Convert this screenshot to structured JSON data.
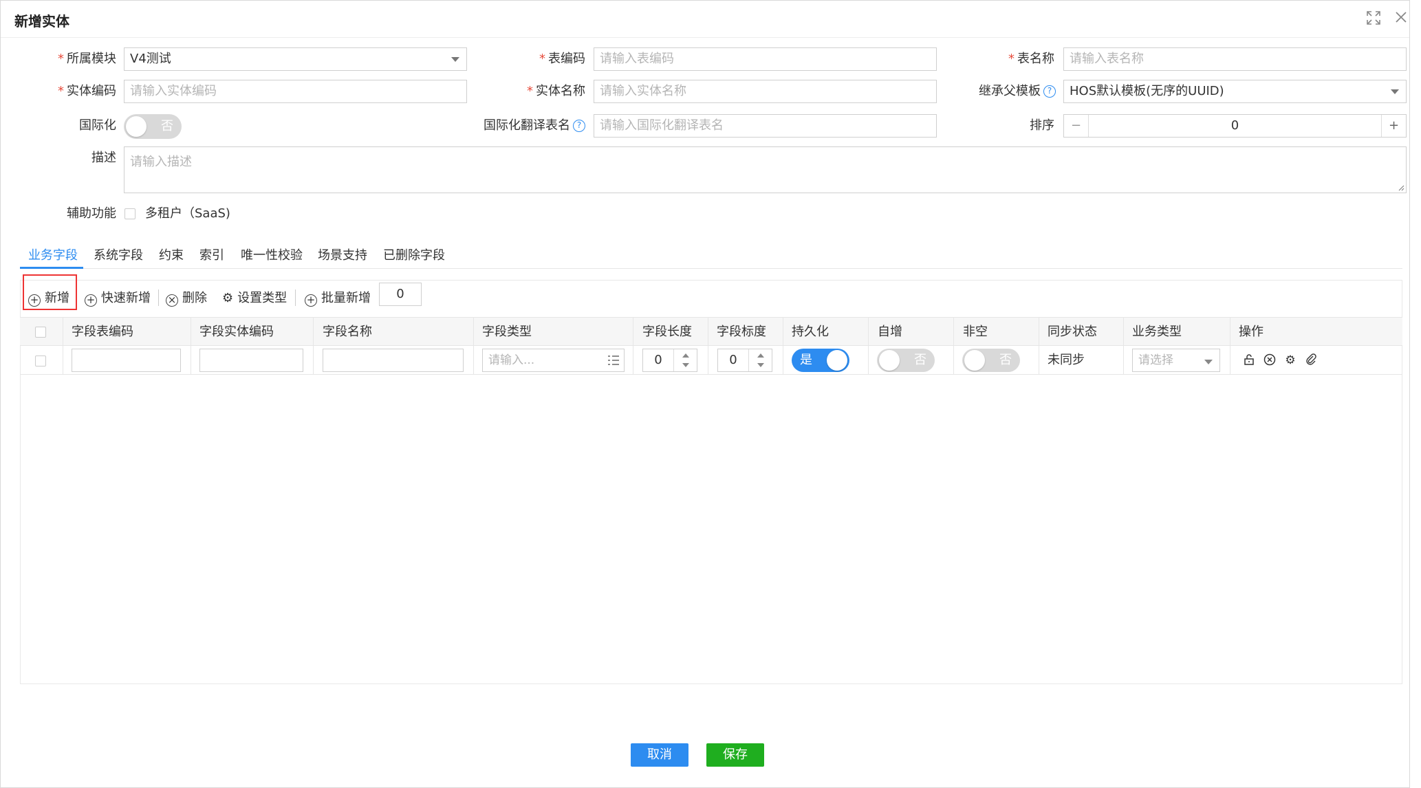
{
  "dialog": {
    "title": "新增实体"
  },
  "form": {
    "module": {
      "label": "所属模块",
      "value": "V4测试"
    },
    "table_code": {
      "label": "表编码",
      "placeholder": "请输入表编码"
    },
    "table_name": {
      "label": "表名称",
      "placeholder": "请输入表名称"
    },
    "entity_code": {
      "label": "实体编码",
      "placeholder": "请输入实体编码"
    },
    "entity_name": {
      "label": "实体名称",
      "placeholder": "请输入实体名称"
    },
    "parent_template": {
      "label": "继承父模板",
      "value": "HOS默认模板(无序的UUID)"
    },
    "i18n": {
      "label": "国际化",
      "toggle": "否"
    },
    "i18n_table": {
      "label": "国际化翻译表名",
      "placeholder": "请输入国际化翻译表名"
    },
    "sort": {
      "label": "排序",
      "minus": "−",
      "plus": "+",
      "value": "0"
    },
    "description": {
      "label": "描述",
      "placeholder": "请输入描述"
    },
    "aux": {
      "label": "辅助功能",
      "option": "多租户（SaaS)"
    }
  },
  "tabs": [
    "业务字段",
    "系统字段",
    "约束",
    "索引",
    "唯一性校验",
    "场景支持",
    "已删除字段"
  ],
  "toolbar": {
    "add": "新增",
    "quick_add": "快速新增",
    "delete": "删除",
    "set_type": "设置类型",
    "batch_add": "批量新增",
    "batch_count": "0"
  },
  "table": {
    "columns": [
      "字段表编码",
      "字段实体编码",
      "字段名称",
      "字段类型",
      "字段长度",
      "字段标度",
      "持久化",
      "自增",
      "非空",
      "同步状态",
      "业务类型",
      "操作"
    ],
    "row": {
      "field_type_placeholder": "请输入...",
      "length": "0",
      "scale": "0",
      "persist": "是",
      "auto_inc": "否",
      "not_null": "否",
      "sync_status": "未同步",
      "biz_type_placeholder": "请选择"
    }
  },
  "footer": {
    "cancel": "取消",
    "save": "保存"
  }
}
